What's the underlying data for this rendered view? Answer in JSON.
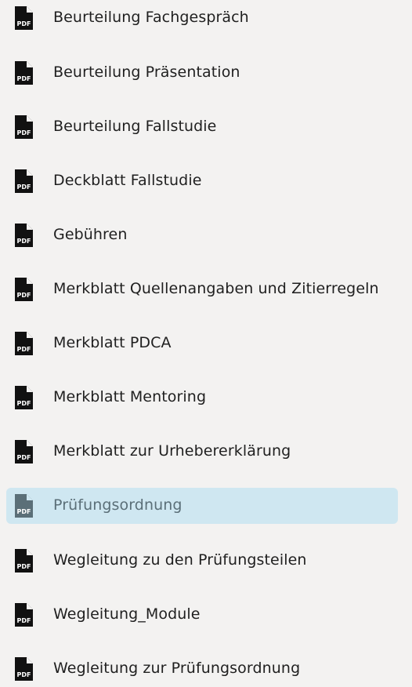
{
  "files": [
    {
      "label": "Beurteilung Fachgespräch",
      "icon": "pdf-file-icon",
      "selected": false
    },
    {
      "label": "Beurteilung Präsentation",
      "icon": "pdf-file-icon",
      "selected": false
    },
    {
      "label": "Beurteilung Fallstudie",
      "icon": "pdf-file-icon",
      "selected": false
    },
    {
      "label": "Deckblatt Fallstudie",
      "icon": "pdf-file-icon",
      "selected": false
    },
    {
      "label": "Gebühren",
      "icon": "pdf-file-icon",
      "selected": false
    },
    {
      "label": "Merkblatt Quellenangaben und Zitierregeln",
      "icon": "pdf-file-icon",
      "selected": false
    },
    {
      "label": "Merkblatt PDCA",
      "icon": "pdf-file-icon",
      "selected": false
    },
    {
      "label": "Merkblatt Mentoring",
      "icon": "pdf-file-icon",
      "selected": false
    },
    {
      "label": "Merkblatt zur Urhebererklärung",
      "icon": "pdf-file-icon",
      "selected": false
    },
    {
      "label": "Prüfungsordnung",
      "icon": "pdf-file-icon",
      "selected": true
    },
    {
      "label": "Wegleitung zu den Prüfungsteilen",
      "icon": "pdf-file-icon",
      "selected": false
    },
    {
      "label": "Wegleitung_Module",
      "icon": "pdf-file-icon",
      "selected": false
    },
    {
      "label": "Wegleitung zur Prüfungsordnung",
      "icon": "pdf-file-icon",
      "selected": false
    }
  ],
  "icon_text": "PDF",
  "colors": {
    "background": "#f3f2f1",
    "selected_background": "#cfe7f1",
    "selected_text": "#5b6f78",
    "icon": "#111111",
    "selected_icon": "#5b6f78"
  }
}
